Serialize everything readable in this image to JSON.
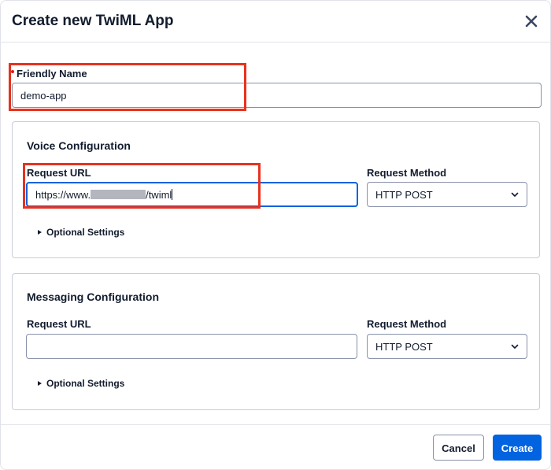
{
  "dialog": {
    "title": "Create new TwiML App",
    "close_icon": "close-icon"
  },
  "friendly_name": {
    "label": "Friendly Name",
    "value": "demo-app"
  },
  "voice": {
    "title": "Voice Configuration",
    "request_url_label": "Request URL",
    "request_url_prefix": "https://www.",
    "request_url_suffix": "/twiml",
    "request_method_label": "Request Method",
    "request_method_value": "HTTP POST",
    "optional_settings": "Optional Settings"
  },
  "messaging": {
    "title": "Messaging Configuration",
    "request_url_label": "Request URL",
    "request_url_value": "",
    "request_method_label": "Request Method",
    "request_method_value": "HTTP POST",
    "optional_settings": "Optional Settings"
  },
  "footer": {
    "cancel_label": "Cancel",
    "create_label": "Create"
  },
  "colors": {
    "primary": "#0263e0",
    "highlight": "#e8321e",
    "text": "#121c2d"
  }
}
